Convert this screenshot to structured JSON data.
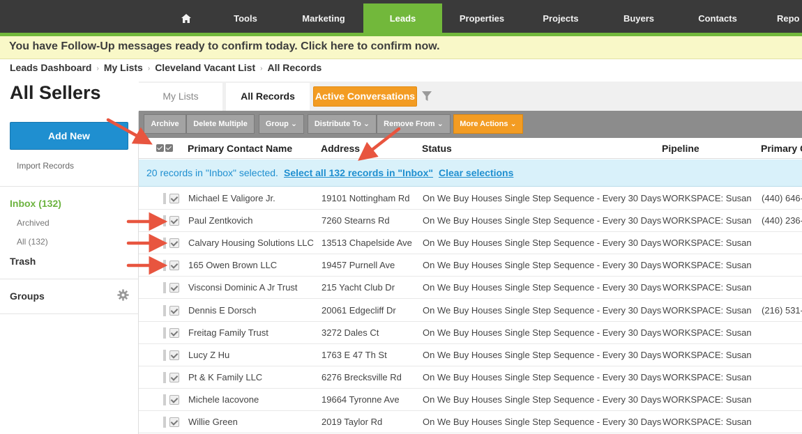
{
  "nav": {
    "home_icon": "home-icon",
    "items": [
      "Tools",
      "Marketing",
      "Leads",
      "Properties",
      "Projects",
      "Buyers",
      "Contacts",
      "Repo"
    ],
    "active": "Leads"
  },
  "banner": "You have Follow-Up messages ready to confirm today. Click here to confirm now.",
  "breadcrumb": [
    "Leads Dashboard",
    "My Lists",
    "Cleveland Vacant List",
    "All Records"
  ],
  "page_title": "All Sellers",
  "tabs": {
    "my_lists": "My Lists",
    "all_records": "All Records",
    "active_conversations": "Active Conversations"
  },
  "sidebar": {
    "add_new": "Add New",
    "import_records": "Import Records",
    "inbox": "Inbox (132)",
    "archived": "Archived",
    "all": "All (132)",
    "trash": "Trash",
    "groups": "Groups"
  },
  "toolbar": {
    "archive": "Archive",
    "delete_multiple": "Delete Multiple",
    "group": "Group ⌄",
    "distribute_to": "Distribute To ⌄",
    "remove_from": "Remove From ⌄",
    "more_actions": "More Actions ⌄"
  },
  "table": {
    "headers": {
      "name": "Primary Contact Name",
      "address": "Address",
      "status": "Status",
      "pipeline": "Pipeline",
      "phone": "Primary C"
    },
    "selection": {
      "text": "20 records in \"Inbox\" selected.",
      "select_all": "Select all 132 records in \"Inbox\"",
      "clear": "Clear selections"
    },
    "rows": [
      {
        "name": "Michael E Valigore Jr.",
        "address": "19101 Nottingham Rd",
        "status": "On We Buy Houses Single Step Sequence - Every 30 Days",
        "pipeline": "WORKSPACE: Susan",
        "phone": "(440) 646-"
      },
      {
        "name": "Paul Zentkovich",
        "address": "7260 Stearns Rd",
        "status": "On We Buy Houses Single Step Sequence - Every 30 Days",
        "pipeline": "WORKSPACE: Susan",
        "phone": "(440) 236-"
      },
      {
        "name": "Calvary Housing Solutions LLC",
        "address": "13513 Chapelside Ave",
        "status": "On We Buy Houses Single Step Sequence - Every 30 Days",
        "pipeline": "WORKSPACE: Susan",
        "phone": ""
      },
      {
        "name": "165 Owen Brown LLC",
        "address": "19457 Purnell Ave",
        "status": "On We Buy Houses Single Step Sequence - Every 30 Days",
        "pipeline": "WORKSPACE: Susan",
        "phone": ""
      },
      {
        "name": "Visconsi Dominic A Jr Trust",
        "address": "215 Yacht Club Dr",
        "status": "On We Buy Houses Single Step Sequence - Every 30 Days",
        "pipeline": "WORKSPACE: Susan",
        "phone": ""
      },
      {
        "name": "Dennis E Dorsch",
        "address": "20061 Edgecliff Dr",
        "status": "On We Buy Houses Single Step Sequence - Every 30 Days",
        "pipeline": "WORKSPACE: Susan",
        "phone": "(216) 531-"
      },
      {
        "name": "Freitag Family Trust",
        "address": "3272 Dales Ct",
        "status": "On We Buy Houses Single Step Sequence - Every 30 Days",
        "pipeline": "WORKSPACE: Susan",
        "phone": ""
      },
      {
        "name": "Lucy Z Hu",
        "address": "1763 E 47 Th St",
        "status": "On We Buy Houses Single Step Sequence - Every 30 Days",
        "pipeline": "WORKSPACE: Susan",
        "phone": ""
      },
      {
        "name": "Pt & K Family LLC",
        "address": "6276 Brecksville Rd",
        "status": "On We Buy Houses Single Step Sequence - Every 30 Days",
        "pipeline": "WORKSPACE: Susan",
        "phone": ""
      },
      {
        "name": "Michele Iacovone",
        "address": "19664 Tyronne Ave",
        "status": "On We Buy Houses Single Step Sequence - Every 30 Days",
        "pipeline": "WORKSPACE: Susan",
        "phone": ""
      },
      {
        "name": "Willie Green",
        "address": "2019 Taylor Rd",
        "status": "On We Buy Houses Single Step Sequence - Every 30 Days",
        "pipeline": "WORKSPACE: Susan",
        "phone": ""
      }
    ]
  },
  "colors": {
    "accent_green": "#72b83b",
    "accent_orange": "#f39c23",
    "accent_blue": "#1f8fd0",
    "annotation_arrow": "#e8553f"
  }
}
